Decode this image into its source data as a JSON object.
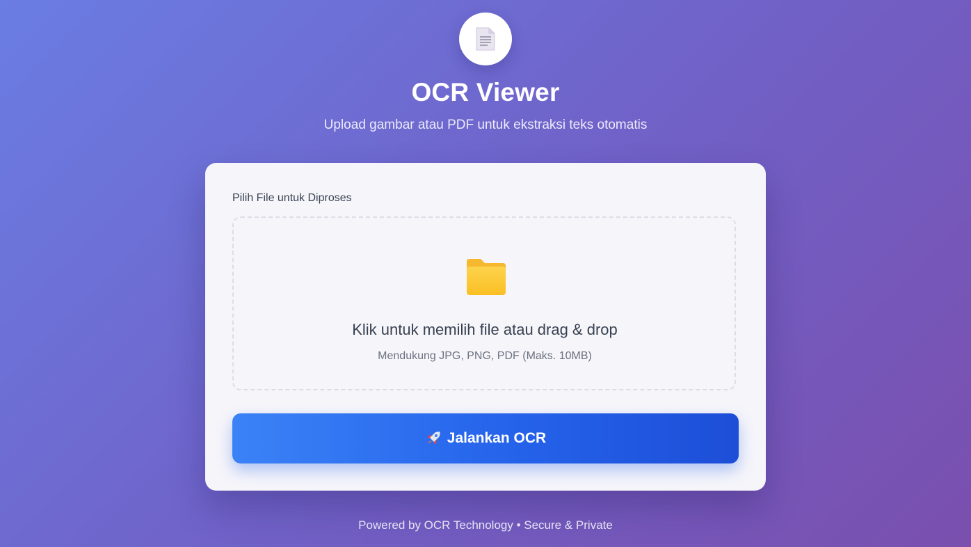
{
  "header": {
    "logo_icon": "document-icon",
    "title": "OCR Viewer",
    "subtitle": "Upload gambar atau PDF untuk ekstraksi teks otomatis"
  },
  "upload": {
    "label": "Pilih File untuk Diproses",
    "icon": "folder-icon",
    "prompt": "Klik untuk memilih file atau drag & drop",
    "hint": "Mendukung JPG, PNG, PDF (Maks. 10MB)"
  },
  "action": {
    "icon": "rocket-icon",
    "label": "Jalankan OCR"
  },
  "footer": {
    "text": "Powered by OCR Technology • Secure & Private"
  },
  "colors": {
    "background_start": "#6a7de3",
    "background_end": "#7a4fae",
    "card": "#f6f5fa",
    "button_start": "#3b82f6",
    "button_end": "#1d4ed8",
    "folder": "#fbbf24"
  }
}
